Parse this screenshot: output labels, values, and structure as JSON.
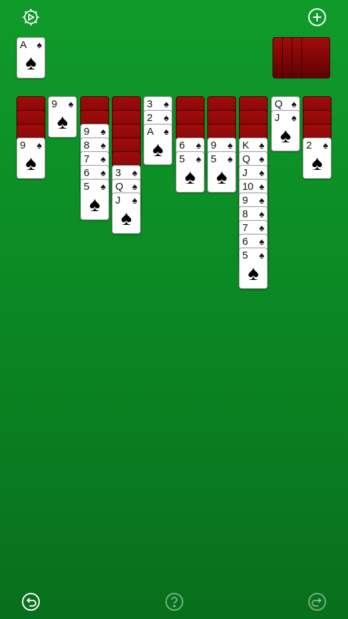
{
  "toolbar": {
    "settings_icon": "settings-gear-icon",
    "new_game_icon": "plus-circle-icon",
    "undo_icon": "undo-icon",
    "help_icon": "help-icon",
    "redo_icon": "redo-icon"
  },
  "colors": {
    "felt": "#0b8a24",
    "card_back": "#7d0606",
    "icon": "#ffffff"
  },
  "foundation": [
    {
      "rank": "A",
      "suit": "♠"
    }
  ],
  "stock": {
    "piles": 4
  },
  "tableau": [
    {
      "hidden": 3,
      "cards": [
        {
          "rank": "9",
          "suit": "♠"
        }
      ]
    },
    {
      "hidden": 0,
      "cards": [
        {
          "rank": "9",
          "suit": "♠"
        }
      ]
    },
    {
      "hidden": 2,
      "cards": [
        {
          "rank": "9",
          "suit": "♠"
        },
        {
          "rank": "8",
          "suit": "♠"
        },
        {
          "rank": "7",
          "suit": "♠"
        },
        {
          "rank": "6",
          "suit": "♠"
        },
        {
          "rank": "5",
          "suit": "♠"
        }
      ]
    },
    {
      "hidden": 5,
      "cards": [
        {
          "rank": "3",
          "suit": "♠"
        },
        {
          "rank": "Q",
          "suit": "♠"
        },
        {
          "rank": "J",
          "suit": "♠"
        }
      ]
    },
    {
      "hidden": 0,
      "cards": [
        {
          "rank": "3",
          "suit": "♠"
        },
        {
          "rank": "2",
          "suit": "♠"
        },
        {
          "rank": "A",
          "suit": "♠"
        }
      ]
    },
    {
      "hidden": 3,
      "cards": [
        {
          "rank": "6",
          "suit": "♠"
        },
        {
          "rank": "5",
          "suit": "♠"
        }
      ]
    },
    {
      "hidden": 3,
      "cards": [
        {
          "rank": "9",
          "suit": "♠"
        },
        {
          "rank": "5",
          "suit": "♠"
        }
      ]
    },
    {
      "hidden": 3,
      "cards": [
        {
          "rank": "K",
          "suit": "♠"
        },
        {
          "rank": "Q",
          "suit": "♠"
        },
        {
          "rank": "J",
          "suit": "♠"
        },
        {
          "rank": "10",
          "suit": "♠"
        },
        {
          "rank": "9",
          "suit": "♠"
        },
        {
          "rank": "8",
          "suit": "♠"
        },
        {
          "rank": "7",
          "suit": "♠"
        },
        {
          "rank": "6",
          "suit": "♠"
        },
        {
          "rank": "5",
          "suit": "♠"
        }
      ]
    },
    {
      "hidden": 0,
      "cards": [
        {
          "rank": "Q",
          "suit": "♠"
        },
        {
          "rank": "J",
          "suit": "♠"
        }
      ]
    },
    {
      "hidden": 3,
      "cards": [
        {
          "rank": "2",
          "suit": "♠"
        }
      ]
    }
  ]
}
